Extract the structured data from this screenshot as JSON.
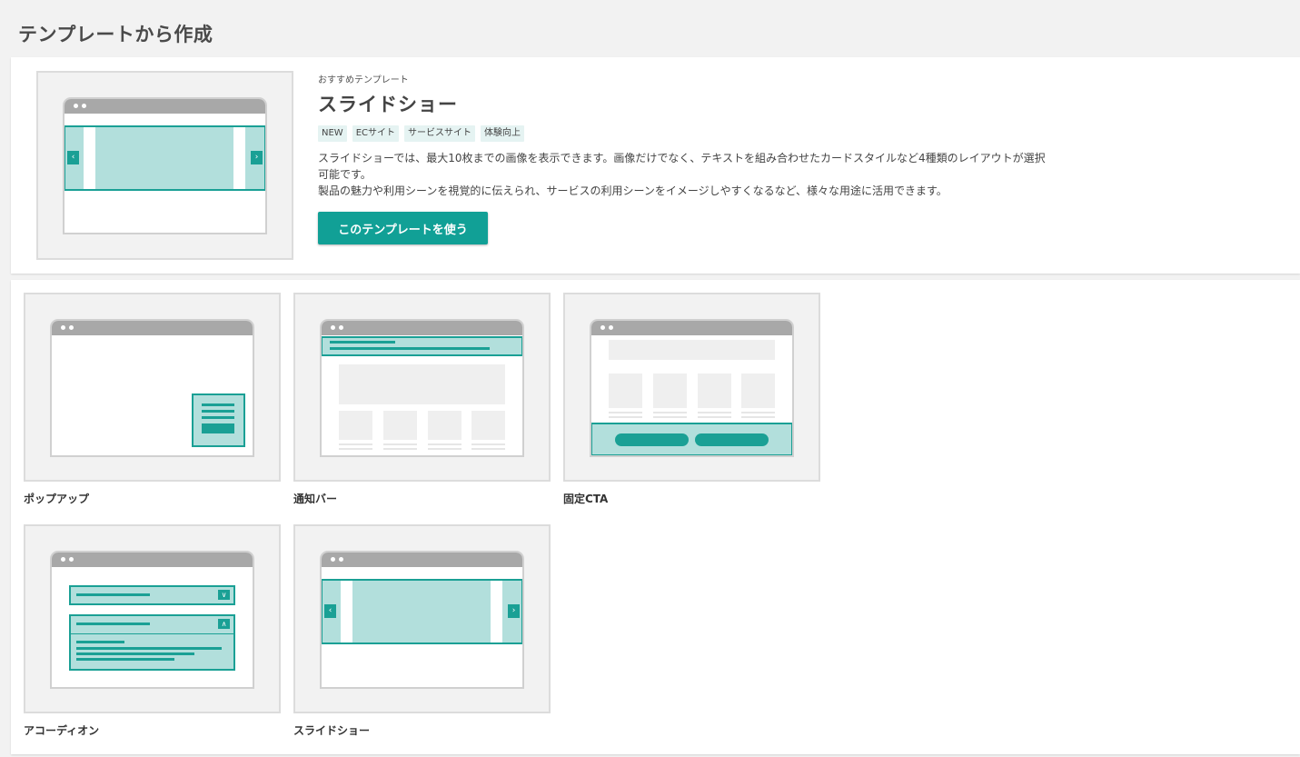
{
  "page": {
    "title": "テンプレートから作成"
  },
  "featured": {
    "eyebrow": "おすすめテンプレート",
    "title": "スライドショー",
    "tags": [
      "NEW",
      "ECサイト",
      "サービスサイト",
      "体験向上"
    ],
    "description": [
      "スライドショーでは、最大10枚までの画像を表示できます。画像だけでなく、テキストを組み合わせたカードスタイルなど4種類のレイアウトが選択",
      "可能です。",
      "製品の魅力や利用シーンを視覚的に伝えられ、サービスの利用シーンをイメージしやすくなるなど、様々な用途に活用できます。"
    ],
    "button_label": "このテンプレートを使う"
  },
  "templates": [
    {
      "label": "ポップアップ",
      "icon": "popup-preview-icon"
    },
    {
      "label": "通知バー",
      "icon": "notification-bar-preview-icon"
    },
    {
      "label": "固定CTA",
      "icon": "fixed-cta-preview-icon"
    },
    {
      "label": "アコーディオン",
      "icon": "accordion-preview-icon"
    },
    {
      "label": "スライドショー",
      "icon": "slideshow-preview-icon"
    }
  ],
  "colors": {
    "accent": "#11a096",
    "accent_light": "#b2dfdc",
    "background": "#f2f2f2"
  },
  "icons": {
    "arrow_left": "‹",
    "arrow_right": "›",
    "chevron_down": "∨",
    "chevron_up": "∧"
  }
}
